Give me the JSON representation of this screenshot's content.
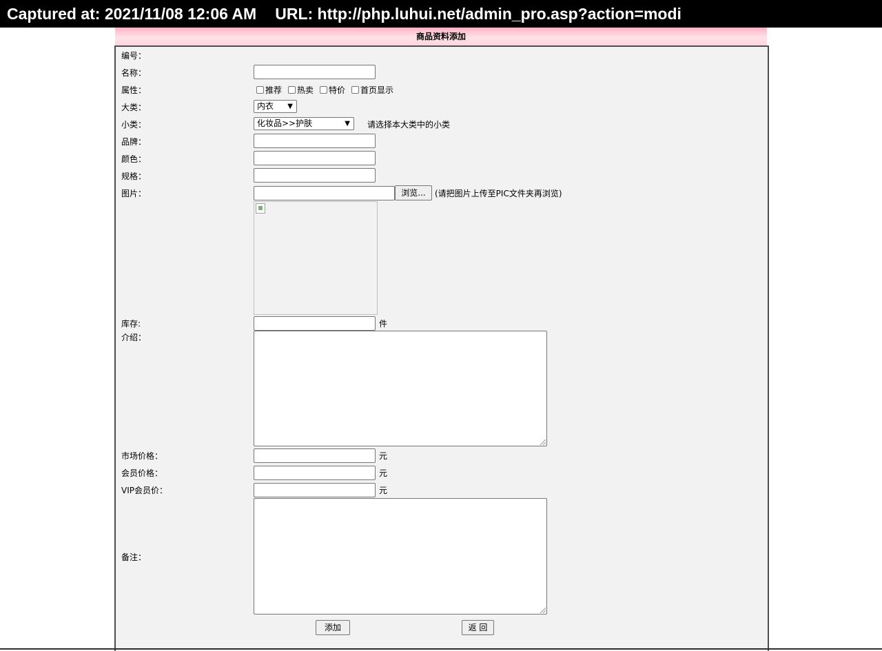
{
  "capture_bar": {
    "captured": "Captured at: 2021/11/08 12:06 AM",
    "url": "URL: http://php.luhui.net/admin_pro.asp?action=modi"
  },
  "form": {
    "title": "商品资料添加",
    "labels": {
      "code": "编号：",
      "name": "名称：",
      "attributes": "属性：",
      "major_category": "大类：",
      "minor_category": "小类：",
      "brand": "品牌：",
      "color": "颜色：",
      "spec": "规格：",
      "picture": "图片：",
      "stock": "库存:",
      "intro": "介绍：",
      "market_price": "市场价格：",
      "member_price": "会员价格：",
      "vip_price": "VIP会员价：",
      "remarks": "备注："
    },
    "attribute_options": [
      "推荐",
      "热卖",
      "特价",
      "首页显示"
    ],
    "major_category_value": "内衣",
    "minor_category_value": "化妆品>>护肤",
    "minor_category_hint": "请选择本大类中的小类",
    "browse_button": "浏览...",
    "picture_hint": "(请把图片上传至PIC文件夹再浏览)",
    "units": {
      "stock": "件",
      "price": "元"
    },
    "submit_button": "添加",
    "back_button": "返 回"
  }
}
